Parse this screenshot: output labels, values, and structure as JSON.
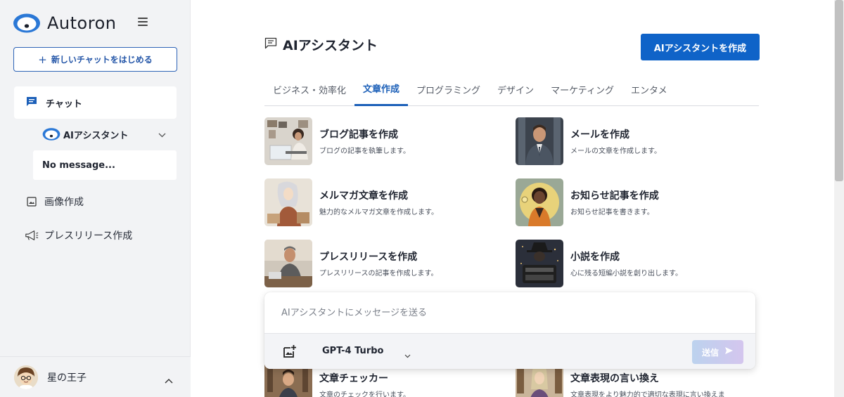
{
  "sidebar": {
    "brand": "Autoron",
    "new_chat_label": "新しいチャットをはじめる",
    "chat_label": "チャット",
    "assistant_label": "AIアシスタント",
    "no_message": "No message...",
    "image_label": "画像作成",
    "press_label": "プレスリリース作成",
    "user_name": "星の王子"
  },
  "main": {
    "title": "AIアシスタント",
    "create_button": "AIアシスタントを作成",
    "tabs": [
      {
        "label": "ビジネス・効率化"
      },
      {
        "label": "文章作成",
        "active": true
      },
      {
        "label": "プログラミング"
      },
      {
        "label": "デザイン"
      },
      {
        "label": "マーケティング"
      },
      {
        "label": "エンタメ"
      }
    ],
    "cards": [
      {
        "title": "ブログ記事を作成",
        "desc": "ブログの記事を執筆します。"
      },
      {
        "title": "メールを作成",
        "desc": "メールの文章を作成します。"
      },
      {
        "title": "メルマガ文章を作成",
        "desc": "魅力的なメルマガ文章を作成します。"
      },
      {
        "title": "お知らせ記事を作成",
        "desc": "お知らせ記事を書きます。"
      },
      {
        "title": "プレスリリースを作成",
        "desc": "プレスリリースの記事を作成します。"
      },
      {
        "title": "小説を作成",
        "desc": "心に残る短編小説を創り出します。"
      },
      {
        "title": "文章チェッカー",
        "desc": "文章のチェックを行います。"
      },
      {
        "title": "文章表現の言い換え",
        "desc": "文章表現をより魅力的で適切な表現に言い換えま"
      }
    ]
  },
  "composer": {
    "placeholder": "AIアシスタントにメッセージを送る",
    "model": "GPT-4 Turbo",
    "send_label": "送信"
  },
  "colors": {
    "accent": "#0f63c8",
    "tab_active": "#1b5fb8",
    "sidebar_bg": "#f2f3f5"
  }
}
